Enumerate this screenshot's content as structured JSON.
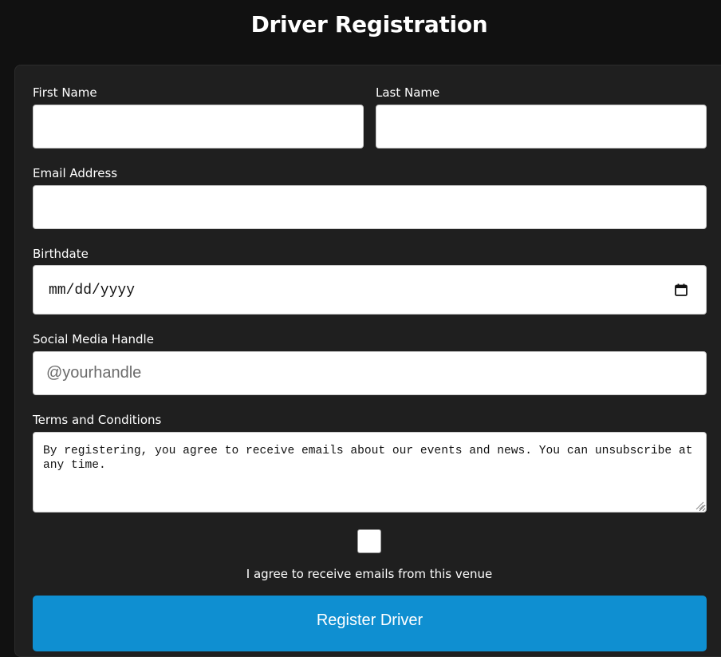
{
  "page": {
    "title": "Driver Registration"
  },
  "form": {
    "first_name": {
      "label": "First Name",
      "value": "",
      "placeholder": ""
    },
    "last_name": {
      "label": "Last Name",
      "value": "",
      "placeholder": ""
    },
    "email": {
      "label": "Email Address",
      "value": "",
      "placeholder": ""
    },
    "birthdate": {
      "label": "Birthdate",
      "display": "mm/dd/yyyy",
      "icon": "calendar-icon"
    },
    "social": {
      "label": "Social Media Handle",
      "value": "",
      "placeholder": "@yourhandle"
    },
    "terms": {
      "label": "Terms and Conditions",
      "text": "By registering, you agree to receive emails about our events and news. You can unsubscribe at any time."
    },
    "consent": {
      "label": "I agree to receive emails from this venue",
      "checked": false
    },
    "submit_label": "Register Driver"
  },
  "colors": {
    "background": "#111111",
    "card": "#1f1f1f",
    "accent": "#0f8fd1",
    "text": "#ffffff"
  }
}
